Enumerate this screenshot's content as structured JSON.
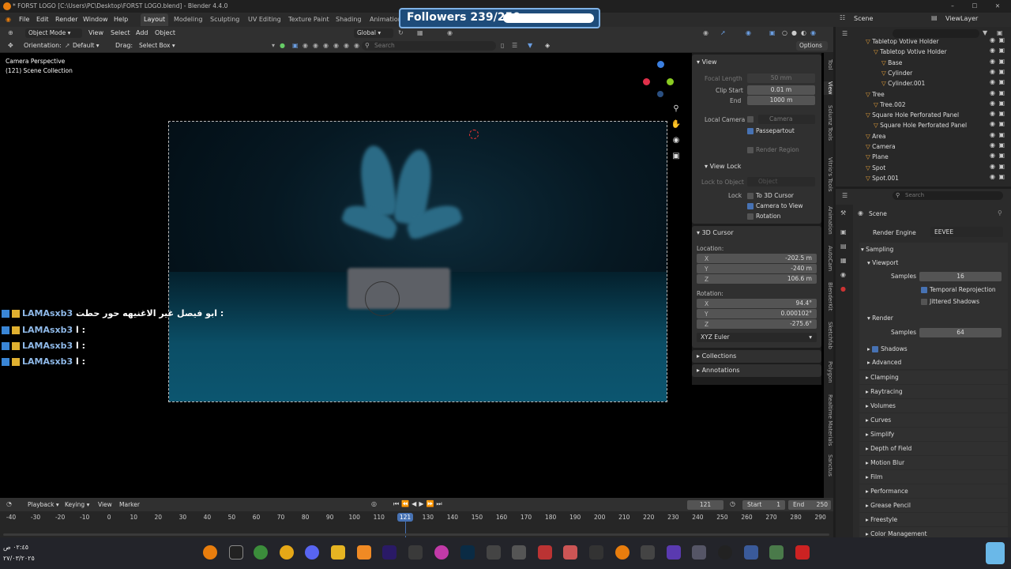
{
  "window": {
    "title": "* FORST LOGO [C:\\Users\\PC\\Desktop\\FORST LOGO.blend] - Blender 4.4.0",
    "controls": [
      "–",
      "☐",
      "✕"
    ]
  },
  "menu": [
    "File",
    "Edit",
    "Render",
    "Window",
    "Help"
  ],
  "workspaces": [
    "Layout",
    "Modeling",
    "Sculpting",
    "UV Editing",
    "Texture Paint",
    "Shading",
    "Animation"
  ],
  "workspace_active": "Layout",
  "top_right": {
    "scene": "Scene",
    "view_layer": "ViewLayer"
  },
  "header": {
    "mode": "Object Mode",
    "menus": [
      "View",
      "Select",
      "Add",
      "Object"
    ],
    "orientation_label": "Orientation:",
    "orientation": "Default",
    "drag_label": "Drag:",
    "drag": "Select Box",
    "transform": "Global",
    "search_placeholder": "Search",
    "options": "Options"
  },
  "viewport": {
    "camera_label": "Camera Perspective",
    "collection_label": "(121) Scene Collection"
  },
  "overlay": {
    "followers": "Followers 239/250",
    "followers_progress": 0.956,
    "chat": [
      {
        "user": "LAMAsxb3",
        "text": "ابو فيصل غير الاغنيهه حور حطت :"
      },
      {
        "user": "LAMAsxb3",
        "text": "ا :"
      },
      {
        "user": "LAMAsxb3",
        "text": "ا :"
      },
      {
        "user": "LAMAsxb3",
        "text": "ا :"
      }
    ]
  },
  "npanel": {
    "view": {
      "title": "View",
      "focal_length_label": "Focal Length",
      "focal_length": "50 mm",
      "clip_start_label": "Clip Start",
      "clip_start": "0.01 m",
      "end_label": "End",
      "end": "1000 m",
      "local_camera_label": "Local Camera",
      "local_camera": "Camera",
      "passepartout": "Passepartout",
      "render_region": "Render Region"
    },
    "view_lock": {
      "title": "View Lock",
      "lock_to_object_label": "Lock to Object",
      "lock_to_object": "Object",
      "lock_label": "Lock",
      "to_3d_cursor": "To 3D Cursor",
      "camera_to_view": "Camera to View",
      "rotation": "Rotation"
    },
    "cursor": {
      "title": "3D Cursor",
      "location_label": "Location:",
      "x": "-202.5 m",
      "y": "-240 m",
      "z": "106.6 m",
      "rotation_label": "Rotation:",
      "rx": "94.4°",
      "ry": "0.000102°",
      "rz": "-275.6°",
      "mode": "XYZ Euler"
    },
    "collections": "Collections",
    "annotations": "Annotations"
  },
  "vtabs": [
    "Tool",
    "View",
    "Solumz Tools",
    "Vitrio's Tools",
    "Animation",
    "AutoCam",
    "BlenderKit",
    "Sketchfab",
    "Polygon",
    "Realtime Materials",
    "Sanctus"
  ],
  "outliner": {
    "search_placeholder": "",
    "rows": [
      {
        "name": "Tabletop Votive Holder",
        "indent": 1
      },
      {
        "name": "Tabletop Votive Holder",
        "indent": 2
      },
      {
        "name": "Base",
        "indent": 3
      },
      {
        "name": "Cylinder",
        "indent": 3
      },
      {
        "name": "Cylinder.001",
        "indent": 3
      },
      {
        "name": "Tree",
        "indent": 1
      },
      {
        "name": "Tree.002",
        "indent": 2
      },
      {
        "name": "Square Hole Perforated Panel",
        "indent": 1
      },
      {
        "name": "Square Hole Perforated Panel",
        "indent": 2
      },
      {
        "name": "Area",
        "indent": 1
      },
      {
        "name": "Camera",
        "indent": 1
      },
      {
        "name": "Plane",
        "indent": 1
      },
      {
        "name": "Spot",
        "indent": 1
      },
      {
        "name": "Spot.001",
        "indent": 1
      }
    ]
  },
  "properties": {
    "search_placeholder": "Search",
    "scene": "Scene",
    "render_engine_label": "Render Engine",
    "render_engine": "EEVEE",
    "sampling": "Sampling",
    "viewport": "Viewport",
    "samples_label": "Samples",
    "viewport_samples": "16",
    "temporal_reprojection": "Temporal Reprojection",
    "jittered_shadows": "Jittered Shadows",
    "render": "Render",
    "render_samples": "64",
    "shadows": "Shadows",
    "advanced": "Advanced",
    "sections": [
      "Clamping",
      "Raytracing",
      "Volumes",
      "Curves",
      "Simplify",
      "Depth of Field",
      "Motion Blur",
      "Film",
      "Performance",
      "Grease Pencil",
      "Freestyle",
      "Color Management"
    ]
  },
  "timeline": {
    "menus": [
      "Playback",
      "Keying",
      "View",
      "Marker"
    ],
    "current_frame": "121",
    "start_label": "Start",
    "start": "1",
    "end_label": "End",
    "end": "250",
    "ticks": [
      "-40",
      "-30",
      "-20",
      "-10",
      "0",
      "10",
      "20",
      "30",
      "40",
      "50",
      "60",
      "70",
      "80",
      "90",
      "100",
      "110",
      "120",
      "130",
      "140",
      "150",
      "160",
      "170",
      "180",
      "190",
      "200",
      "210",
      "220",
      "230",
      "240",
      "250",
      "260",
      "270",
      "280",
      "290"
    ]
  },
  "taskbar": {
    "time": "٠٢:٤٥ ص",
    "date": "٢٧/٠٣/٢٠٢٥"
  }
}
